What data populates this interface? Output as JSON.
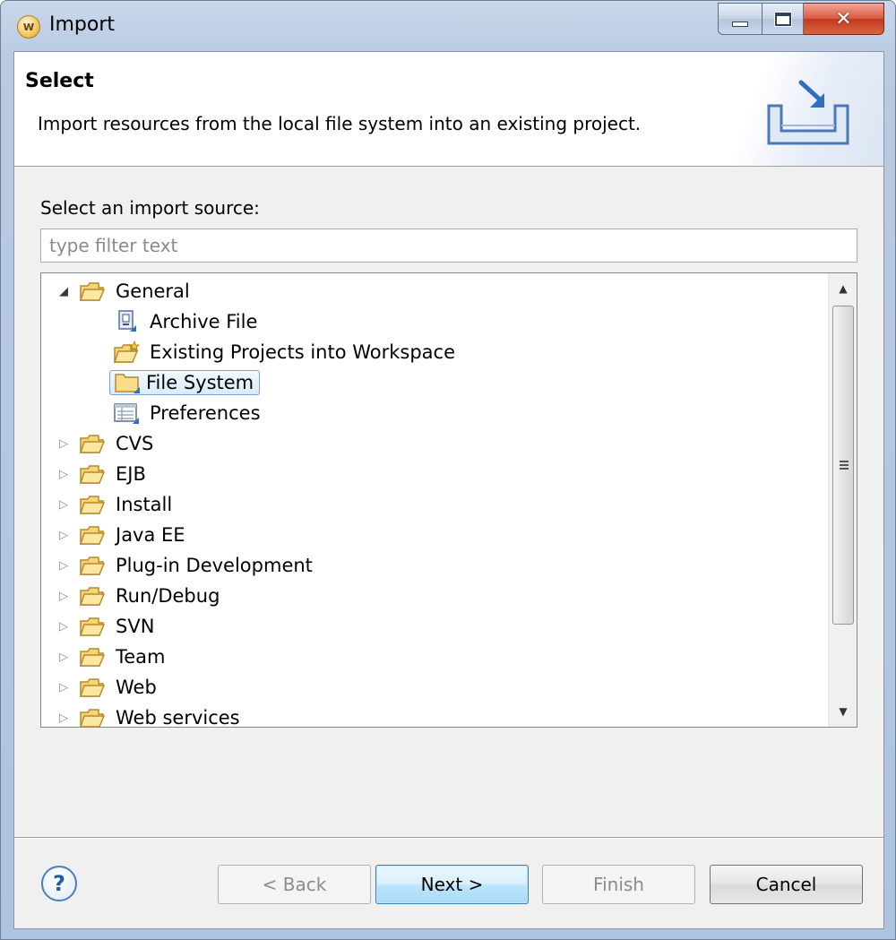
{
  "window": {
    "title": "Import",
    "app_icon_letter": "w"
  },
  "header": {
    "title": "Select",
    "description": "Import resources from the local file system into an existing project."
  },
  "source": {
    "label": "Select an import source:",
    "filter_placeholder": "type filter text",
    "filter_value": ""
  },
  "tree": {
    "items": [
      {
        "label": "General",
        "expanded": true,
        "icon": "folder-open-icon"
      },
      {
        "label": "Archive File",
        "icon": "archive-file-icon",
        "child": true
      },
      {
        "label": "Existing Projects into Workspace",
        "icon": "existing-projects-icon",
        "child": true
      },
      {
        "label": "File System",
        "icon": "folder-icon",
        "child": true,
        "selected": true
      },
      {
        "label": "Preferences",
        "icon": "preferences-icon",
        "child": true
      },
      {
        "label": "CVS",
        "expanded": false,
        "icon": "folder-open-icon"
      },
      {
        "label": "EJB",
        "expanded": false,
        "icon": "folder-open-icon"
      },
      {
        "label": "Install",
        "expanded": false,
        "icon": "folder-open-icon"
      },
      {
        "label": "Java EE",
        "expanded": false,
        "icon": "folder-open-icon"
      },
      {
        "label": "Plug-in Development",
        "expanded": false,
        "icon": "folder-open-icon"
      },
      {
        "label": "Run/Debug",
        "expanded": false,
        "icon": "folder-open-icon"
      },
      {
        "label": "SVN",
        "expanded": false,
        "icon": "folder-open-icon"
      },
      {
        "label": "Team",
        "expanded": false,
        "icon": "folder-open-icon"
      },
      {
        "label": "Web",
        "expanded": false,
        "icon": "folder-open-icon"
      },
      {
        "label": "Web services",
        "expanded": false,
        "icon": "folder-open-icon"
      }
    ]
  },
  "buttons": {
    "back": "< Back",
    "next": "Next >",
    "finish": "Finish",
    "cancel": "Cancel",
    "help": "?"
  },
  "colors": {
    "selection_border": "#7da2ce",
    "default_button": "#3c7fb1"
  }
}
